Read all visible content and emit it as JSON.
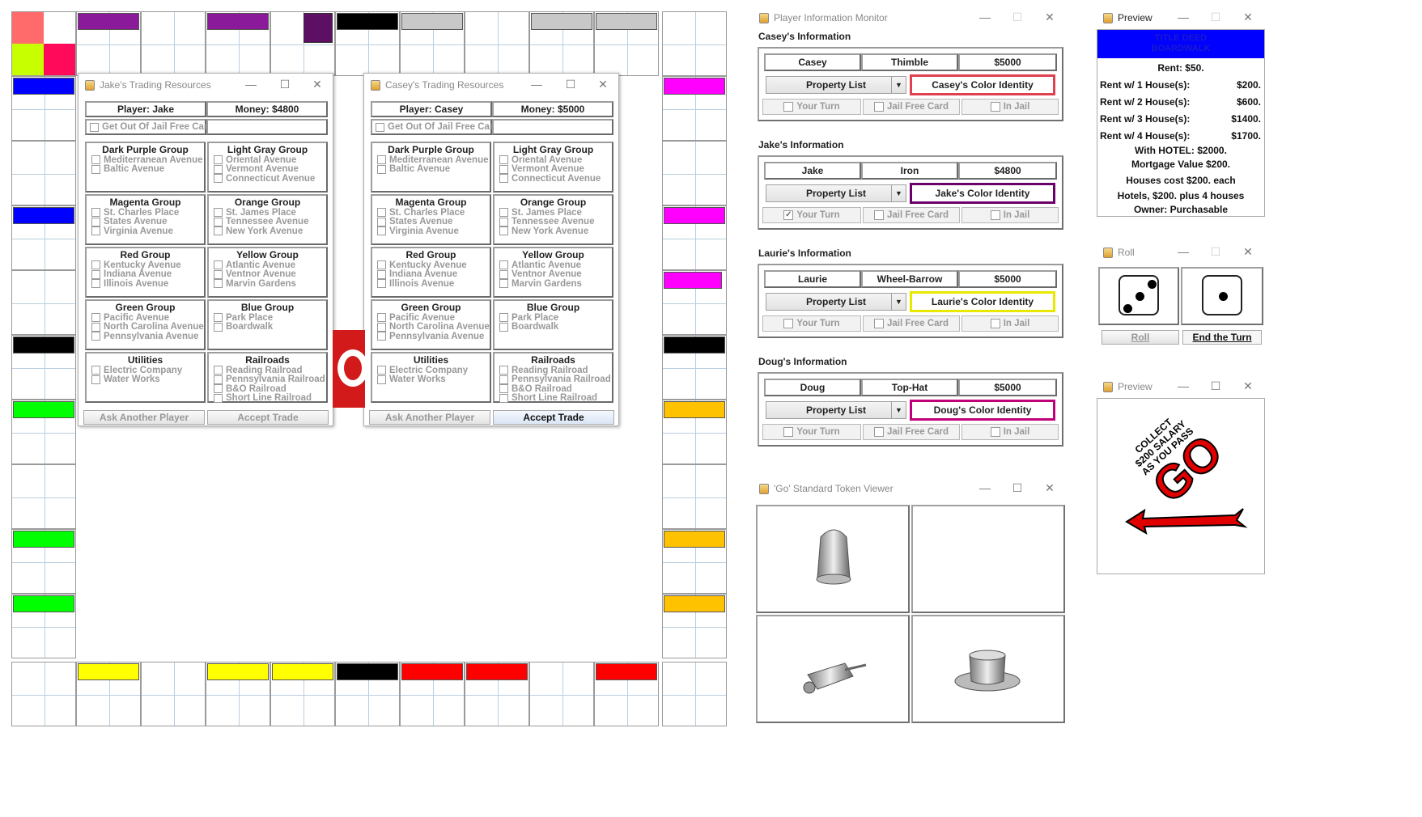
{
  "colors": {
    "dark_purple": "#8b1a9b",
    "dark_purple2": "#5c0f63",
    "light_gray": "#c8c8c8",
    "magenta": "#ff00ff",
    "orange": "#ffc200",
    "red": "#ff0000",
    "yellow": "#ffff00",
    "green": "#00ff00",
    "blue": "#0000ff",
    "black": "#000000",
    "corner_red": "#ff6b6b",
    "corner_lime": "#c8ff00",
    "corner_pink": "#ff0a5a",
    "title_deed_blue": "#0000ff"
  },
  "jake_trading": {
    "title": "Jake's Trading Resources",
    "player": "Player: Jake",
    "money": "Money: $4800",
    "jail_card": "Get Out Of Jail Free Card",
    "ask_button": "Ask Another Player",
    "accept_button": "Accept Trade"
  },
  "casey_trading": {
    "title": "Casey's Trading Resources",
    "player": "Player: Casey",
    "money": "Money: $5000",
    "jail_card": "Get Out Of Jail Free Card",
    "ask_button": "Ask Another Player",
    "accept_button": "Accept Trade"
  },
  "groups": [
    {
      "name": "Dark Purple Group",
      "props": [
        "Mediterranean Avenue",
        "Baltic Avenue"
      ]
    },
    {
      "name": "Light Gray Group",
      "props": [
        "Oriental Avenue",
        "Vermont Avenue",
        "Connecticut Avenue"
      ]
    },
    {
      "name": "Magenta Group",
      "props": [
        "St. Charles Place",
        "States Avenue",
        "Virginia Avenue"
      ]
    },
    {
      "name": "Orange Group",
      "props": [
        "St. James Place",
        "Tennessee Avenue",
        "New York Avenue"
      ]
    },
    {
      "name": "Red Group",
      "props": [
        "Kentucky Avenue",
        "Indiana Avenue",
        "Illinois Avenue"
      ]
    },
    {
      "name": "Yellow Group",
      "props": [
        "Atlantic Avenue",
        "Ventnor Avenue",
        "Marvin Gardens"
      ]
    },
    {
      "name": "Green Group",
      "props": [
        "Pacific Avenue",
        "North Carolina Avenue",
        "Pennsylvania Avenue"
      ]
    },
    {
      "name": "Blue Group",
      "props": [
        "Park Place",
        "Boardwalk"
      ]
    },
    {
      "name": "Utilities",
      "props": [
        "Electric Company",
        "Water Works"
      ]
    },
    {
      "name": "Railroads",
      "props": [
        "Reading Railroad",
        "Pennsylvania Railroad",
        "B&O Railroad",
        "Short Line Railroad"
      ]
    }
  ],
  "monitor": {
    "title": "Player Information Monitor",
    "players": [
      {
        "section": "Casey's Information",
        "name": "Casey",
        "token": "Thimble",
        "money": "$5000",
        "list": "Property List",
        "identity": "Casey's Color Identity",
        "color": "#e04050",
        "turn": "Your Turn",
        "turn_checked": false,
        "jail_card": "Jail Free Card",
        "in_jail": "In Jail"
      },
      {
        "section": "Jake's Information",
        "name": "Jake",
        "token": "Iron",
        "money": "$4800",
        "list": "Property List",
        "identity": "Jake's Color Identity",
        "color": "#6a006a",
        "turn": "Your Turn",
        "turn_checked": true,
        "jail_card": "Jail Free Card",
        "in_jail": "In Jail"
      },
      {
        "section": "Laurie's Information",
        "name": "Laurie",
        "token": "Wheel-Barrow",
        "money": "$5000",
        "list": "Property List",
        "identity": "Laurie's Color Identity",
        "color": "#e8e800",
        "turn": "Your Turn",
        "turn_checked": false,
        "jail_card": "Jail Free Card",
        "in_jail": "In Jail"
      },
      {
        "section": "Doug's Information",
        "name": "Doug",
        "token": "Top-Hat",
        "money": "$5000",
        "list": "Property List",
        "identity": "Doug's Color Identity",
        "color": "#c0007a",
        "turn": "Your Turn",
        "turn_checked": false,
        "jail_card": "Jail Free Card",
        "in_jail": "In Jail"
      }
    ]
  },
  "preview_deed": {
    "title": "Preview",
    "deed_line1": "TITLE DEED",
    "deed_line2": "BOARDWALK",
    "rent": "Rent: $50.",
    "rows": [
      {
        "label": "Rent w/ 1 House(s):",
        "value": "$200."
      },
      {
        "label": "Rent w/ 2 House(s):",
        "value": "$600."
      },
      {
        "label": "Rent w/ 3 House(s):",
        "value": "$1400."
      },
      {
        "label": "Rent w/ 4 House(s):",
        "value": "$1700."
      }
    ],
    "hotel": "With HOTEL: $2000.",
    "mortgage": "Mortgage Value $200.",
    "houses": "Houses cost $200. each",
    "hotels": "Hotels, $200. plus 4 houses",
    "owner": "Owner: Purchasable"
  },
  "roll": {
    "title": "Roll",
    "die1": 3,
    "die2": 1,
    "roll_button": "Roll",
    "end_button": "End the Turn"
  },
  "preview_go": {
    "title": "Preview",
    "line1": "COLLECT",
    "line2": "$200 SALARY",
    "line3": "AS YOU PASS",
    "go": "GO"
  },
  "token_viewer": {
    "title": "'Go' Standard Token Viewer",
    "tokens": [
      "thimble",
      "",
      "wheelbarrow",
      "top-hat"
    ]
  }
}
